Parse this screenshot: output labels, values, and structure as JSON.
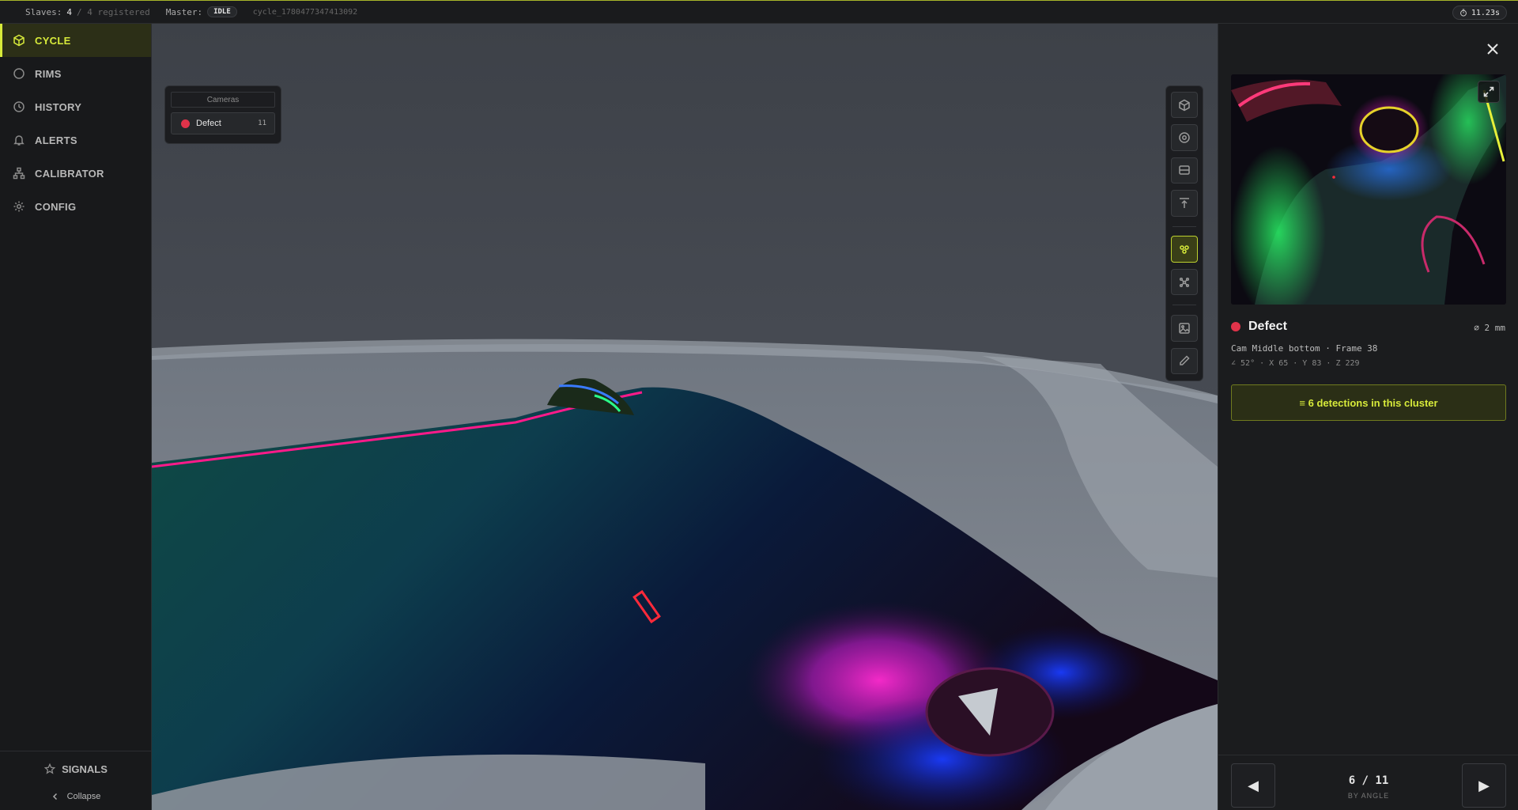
{
  "topbar": {
    "slaves_label": "Slaves:",
    "slaves_count": "4",
    "slaves_registered": "/ 4 registered",
    "master_label": "Master:",
    "master_state": "IDLE",
    "cycle_id": "cycle_1780477347413092",
    "timer": "11.23s"
  },
  "sidebar": {
    "items": [
      {
        "label": "CYCLE",
        "icon": "cube-icon",
        "active": true
      },
      {
        "label": "RIMS",
        "icon": "circle-icon",
        "active": false
      },
      {
        "label": "HISTORY",
        "icon": "clock-icon",
        "active": false
      },
      {
        "label": "ALERTS",
        "icon": "bell-icon",
        "active": false
      },
      {
        "label": "CALIBRATOR",
        "icon": "hierarchy-icon",
        "active": false
      },
      {
        "label": "CONFIG",
        "icon": "gear-icon",
        "active": false
      }
    ],
    "signals_label": "SIGNALS",
    "collapse_label": "Collapse"
  },
  "viewport": {
    "cameras_title": "Cameras",
    "camera_item": {
      "label": "Defect",
      "count": "11"
    },
    "tools": [
      "cube-view-icon",
      "target-icon",
      "section-icon",
      "align-top-icon",
      "cluster-icon",
      "scatter-icon",
      "image-icon",
      "pencil-icon"
    ],
    "active_tool": "cluster-icon"
  },
  "panel": {
    "title": "Defect",
    "size": "⌀ 2 mm",
    "meta_line": "Cam Middle bottom · Frame 38",
    "coords_line": "∠ 52° · X 65 · Y 83 · Z 229",
    "cluster_button": "≡ 6 detections in this cluster",
    "pager": {
      "position": "6 / 11",
      "sort": "BY ANGLE",
      "prev": "◀",
      "next": "▶"
    }
  },
  "colors": {
    "accent": "#d7ea3a",
    "defect": "#e0334a",
    "background": "#1a1b1d"
  }
}
